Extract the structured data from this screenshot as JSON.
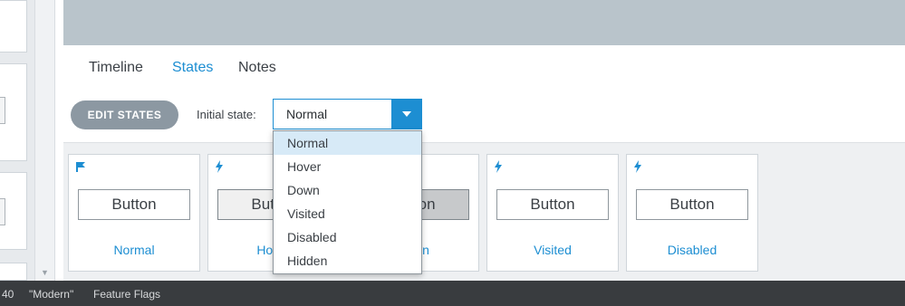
{
  "tabs": [
    {
      "label": "Timeline",
      "active": false
    },
    {
      "label": "States",
      "active": true
    },
    {
      "label": "Notes",
      "active": false
    }
  ],
  "toolbar": {
    "edit_states_label": "EDIT STATES",
    "initial_state_label": "Initial state:",
    "initial_state_value": "Normal"
  },
  "dropdown": {
    "options": [
      "Normal",
      "Hover",
      "Down",
      "Visited",
      "Disabled",
      "Hidden"
    ],
    "selected": "Normal"
  },
  "states": [
    {
      "label": "Normal",
      "button_text": "Button",
      "icon": "flag-icon"
    },
    {
      "label": "Hover",
      "button_text": "Button",
      "icon": "lightning-icon"
    },
    {
      "label": "Down",
      "button_text": "Button",
      "icon": "lightning-icon"
    },
    {
      "label": "Visited",
      "button_text": "Button",
      "icon": "lightning-icon"
    },
    {
      "label": "Disabled",
      "button_text": "Button",
      "icon": "lightning-icon"
    }
  ],
  "status_bar": {
    "item1": "40",
    "item2": "\"Modern\"",
    "item3": "Feature Flags"
  },
  "colors": {
    "accent": "#1d8ed2",
    "banner": "#b9c4cb",
    "status_bar": "#393c3f",
    "edit_button": "#8c98a2"
  }
}
